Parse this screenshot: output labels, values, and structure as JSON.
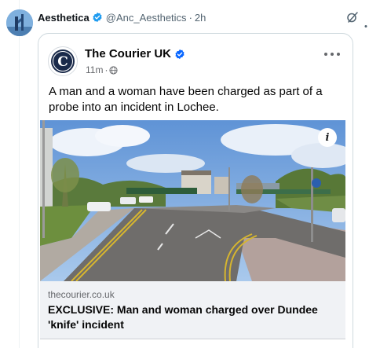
{
  "tweet": {
    "display_name": "Aesthetica",
    "handle": "@Anc_Aesthetics",
    "separator": "·",
    "time": "2h",
    "avatar_icon": "profile-avatar-icon",
    "verified_icon": "verified-badge-icon",
    "grok_icon": "grok-icon"
  },
  "embedded_post": {
    "page_name": "The Courier UK",
    "time": "11m",
    "separator": "·",
    "privacy_icon": "globe-icon",
    "more_icon": "more-options-icon",
    "logo_letter": "C",
    "text": "A man and a woman have been charged as part of a probe into an incident in Lochee.",
    "photo_info_label": "i",
    "link_domain": "thecourier.co.uk",
    "link_title": "EXCLUSIVE: Man and woman charged over Dundee 'knife' incident"
  },
  "colors": {
    "verified_blue": "#1d9bf0",
    "facebook_verified": "#0866ff",
    "courier_navy": "#1a2a4a",
    "link_box_bg": "#f0f2f5"
  }
}
